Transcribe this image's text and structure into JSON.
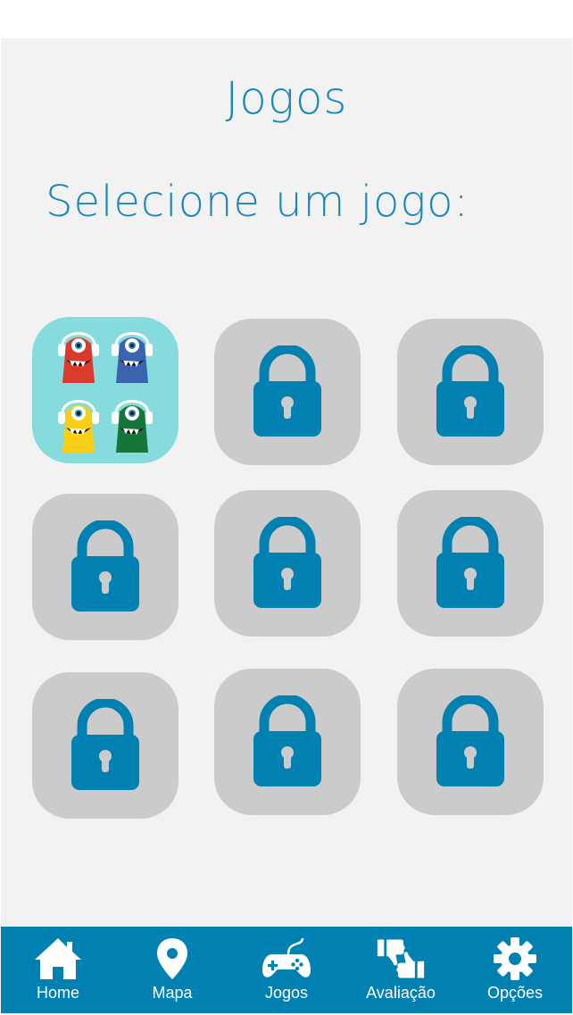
{
  "header": {
    "title": "Jogos"
  },
  "main": {
    "subtitle": "Selecione um jogo:",
    "games": [
      {
        "locked": false,
        "icon": "monster-game-icon"
      },
      {
        "locked": true,
        "icon": "lock-icon"
      },
      {
        "locked": true,
        "icon": "lock-icon"
      },
      {
        "locked": true,
        "icon": "lock-icon"
      },
      {
        "locked": true,
        "icon": "lock-icon"
      },
      {
        "locked": true,
        "icon": "lock-icon"
      },
      {
        "locked": true,
        "icon": "lock-icon"
      },
      {
        "locked": true,
        "icon": "lock-icon"
      },
      {
        "locked": true,
        "icon": "lock-icon"
      }
    ]
  },
  "nav": {
    "items": [
      {
        "label": "Home",
        "icon": "home-icon"
      },
      {
        "label": "Mapa",
        "icon": "map-pin-icon"
      },
      {
        "label": "Jogos",
        "icon": "gamepad-icon"
      },
      {
        "label": "Avaliação",
        "icon": "thumbs-icon"
      },
      {
        "label": "Opções",
        "icon": "gear-icon"
      }
    ]
  },
  "colors": {
    "accent": "#1c87b9",
    "lock": "#0180b2",
    "tile_locked": "#cbcbcb",
    "tile_game": "#86dcdc",
    "nav_bg": "#0180b2",
    "background": "#f2f2f2"
  }
}
